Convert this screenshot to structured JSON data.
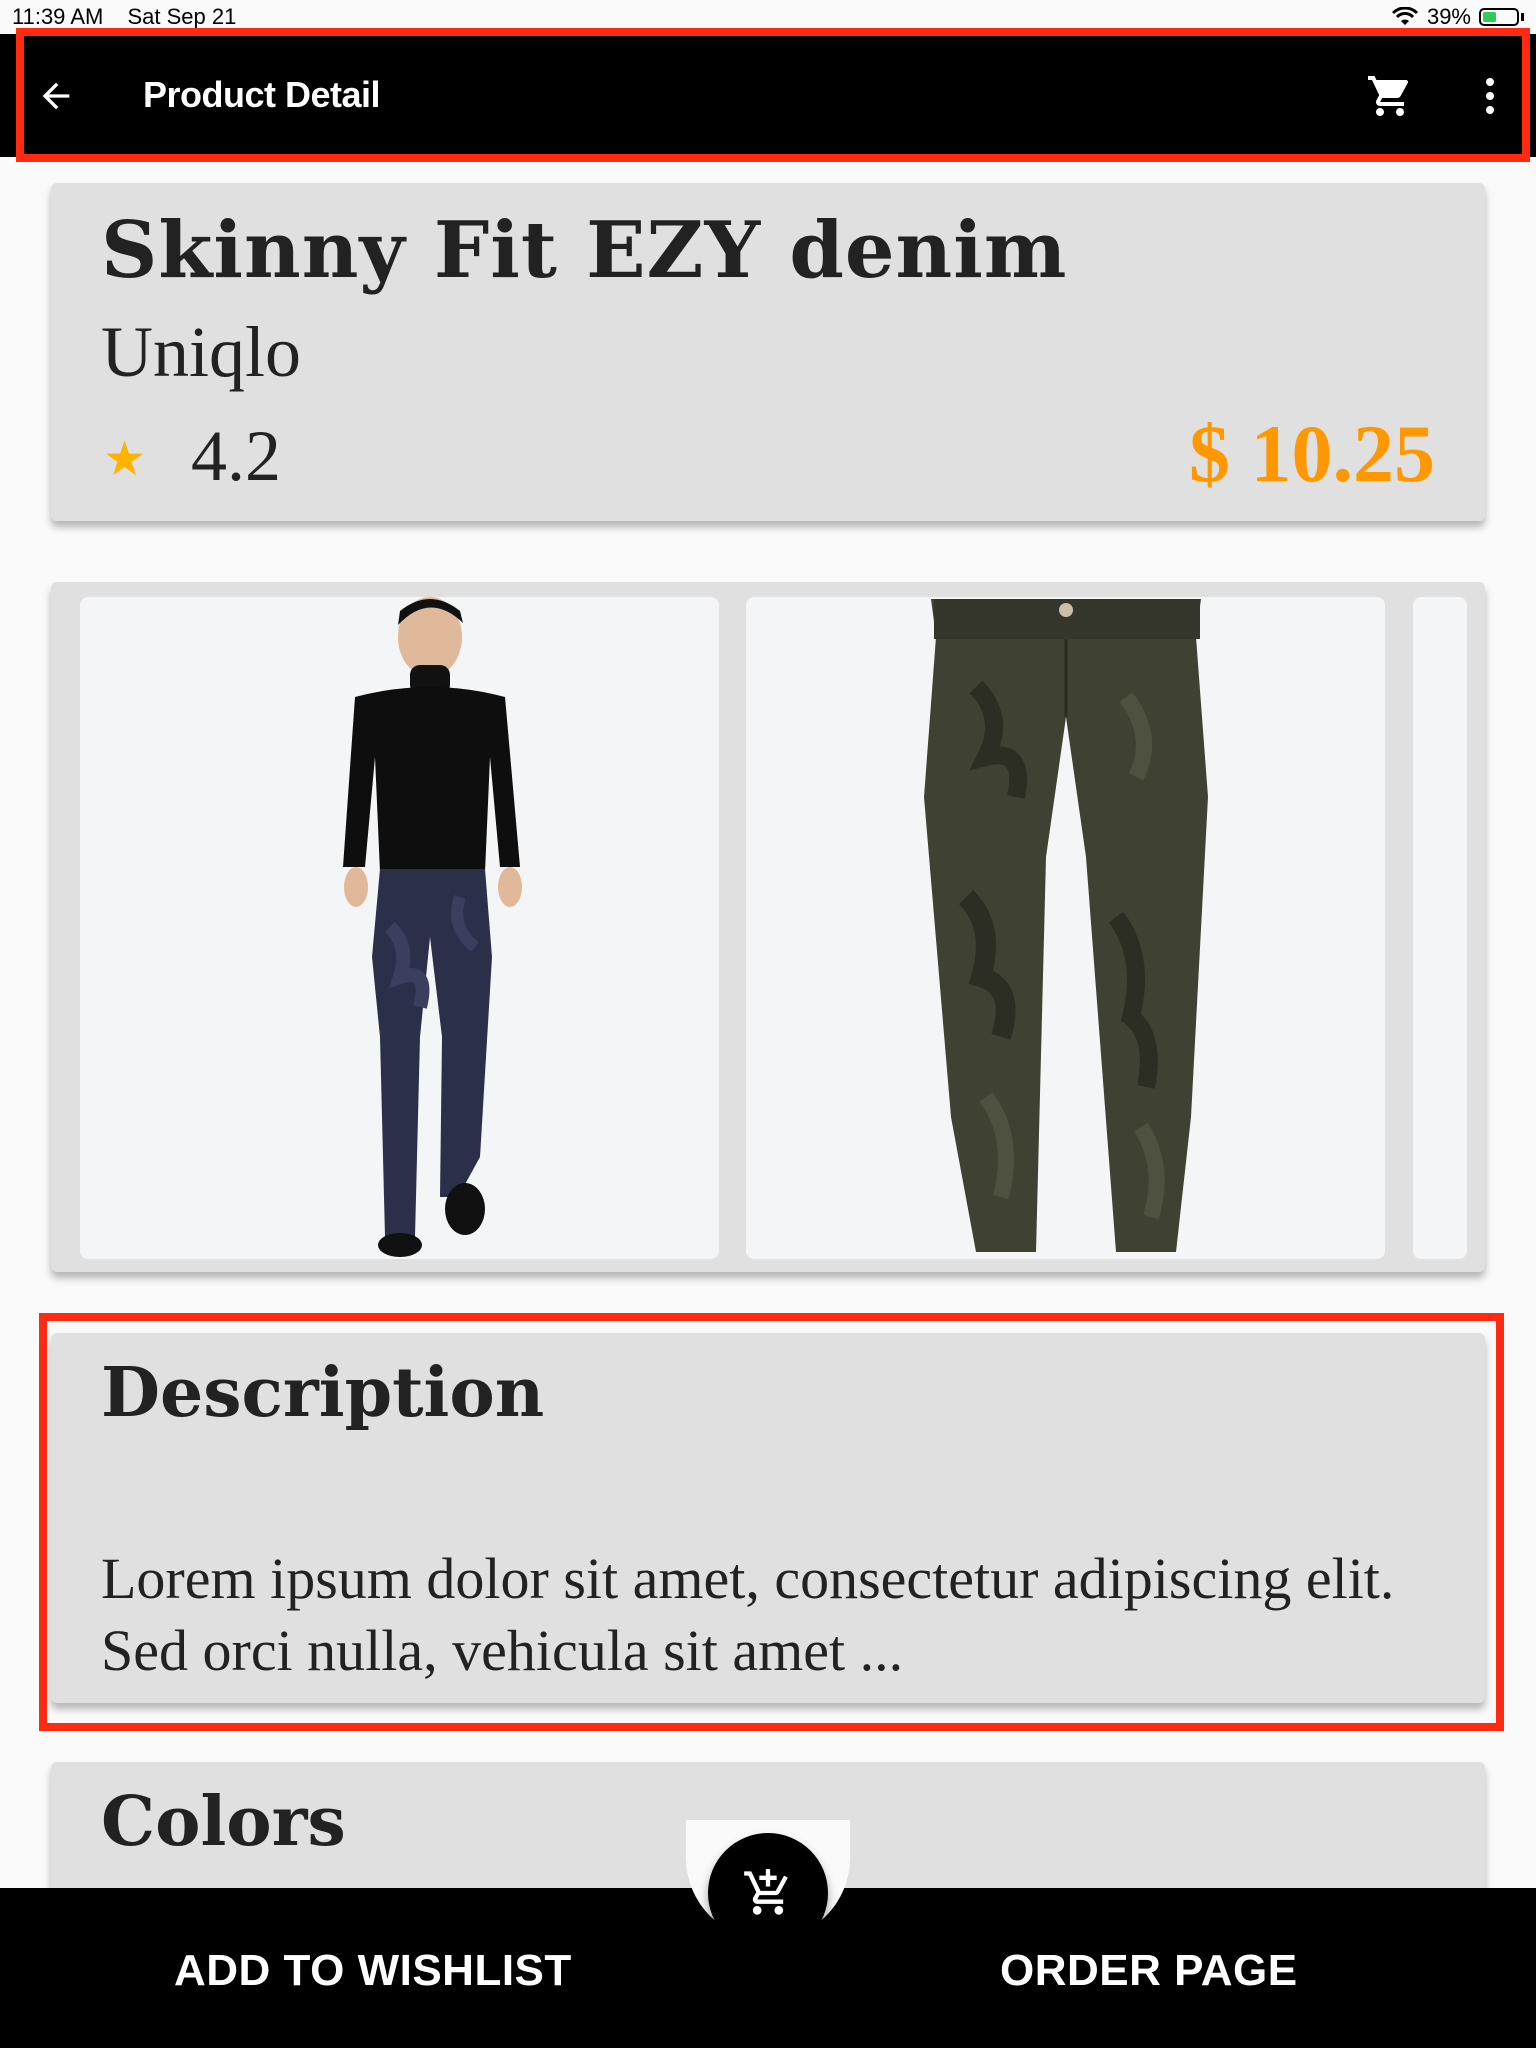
{
  "status_bar": {
    "time": "11:39 AM",
    "date": "Sat Sep 21",
    "battery": "39%"
  },
  "app_bar": {
    "title": "Product Detail",
    "icons": [
      "back-arrow-icon",
      "cart-icon",
      "more-vert-icon"
    ]
  },
  "product": {
    "name": "Skinny Fit EZY denim",
    "brand": "Uniqlo",
    "rating": "4.2",
    "rating_icon": "star-icon",
    "price": "$ 10.25"
  },
  "gallery": {
    "images": [
      "model-wearing-jeans-image",
      "camo-jeans-image",
      "partial-image"
    ]
  },
  "description": {
    "title": "Description",
    "text": "Lorem ipsum dolor sit amet, consectetur adipiscing elit. Sed orci nulla, vehicula sit amet ..."
  },
  "colors": {
    "title": "Colors"
  },
  "bottom_bar": {
    "wishlist_label": "ADD TO WISHLIST",
    "order_label": "ORDER PAGE",
    "fab_icon": "add-shopping-cart-icon"
  },
  "theme": {
    "accent": "#ff9800",
    "star": "#ffb300",
    "appbar": "#000000",
    "card": "#e0e0e0",
    "highlight": "#ff2a0f"
  }
}
